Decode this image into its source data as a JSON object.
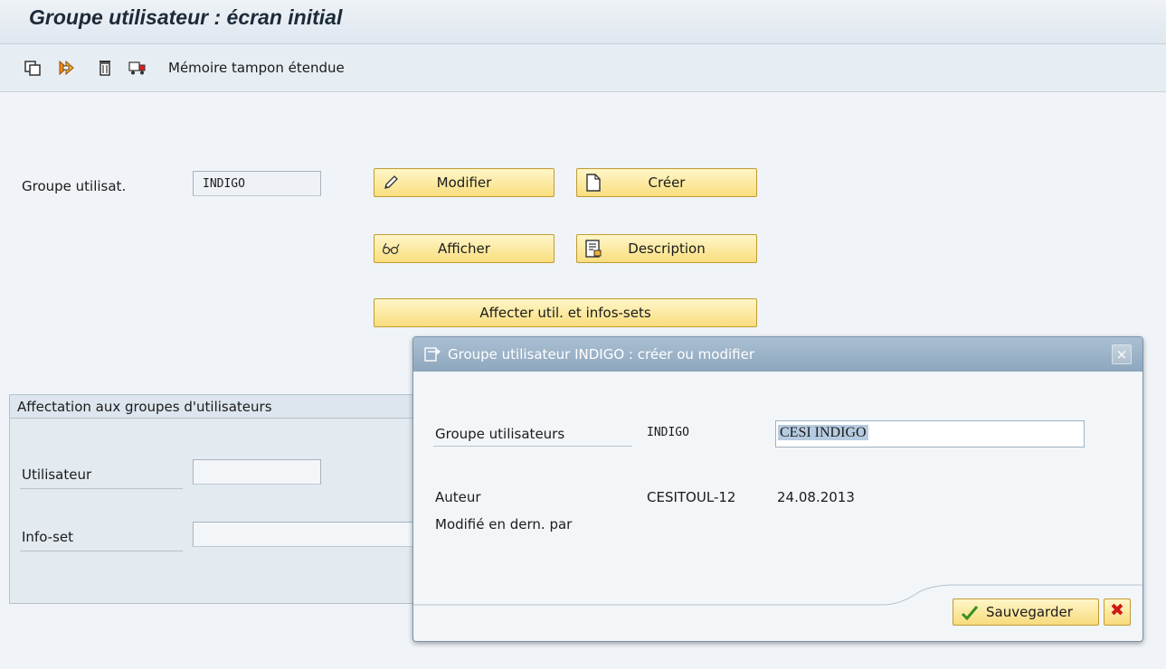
{
  "window": {
    "title": "Groupe utilisateur : écran initial"
  },
  "toolbar": {
    "icons": [
      "copy-icon",
      "transport-icon",
      "delete-icon",
      "truck-icon"
    ],
    "buffer_label": "Mémoire tampon étendue"
  },
  "main": {
    "user_group_label": "Groupe utilisat.",
    "user_group_value": "INDIGO",
    "buttons": {
      "modify": "Modifier",
      "create": "Créer",
      "display": "Afficher",
      "description": "Description",
      "assign": "Affecter util. et infos-sets"
    }
  },
  "assignment": {
    "header": "Affectation aux groupes d'utilisateurs",
    "user_label": "Utilisateur",
    "user_value": "",
    "infoset_label": "Info-set",
    "infoset_value": ""
  },
  "dialog": {
    "title": "Groupe utilisateur INDIGO : créer ou modifier",
    "close_symbol": "×",
    "group_label": "Groupe utilisateurs",
    "group_code": "INDIGO",
    "group_text": "CESI INDIGO",
    "author_label": "Auteur",
    "author_value": "CESITOUL-12",
    "author_date": "24.08.2013",
    "modified_label": "Modifié en dern. par",
    "save_label": "Sauvegarder",
    "cancel_symbol": "✖"
  },
  "colors": {
    "button_fill": "#f9de7e",
    "title_bar": "#8ea7be",
    "selection": "#b6cbe0",
    "cancel_red": "#d01818",
    "save_check_green": "#3a8f1f"
  }
}
